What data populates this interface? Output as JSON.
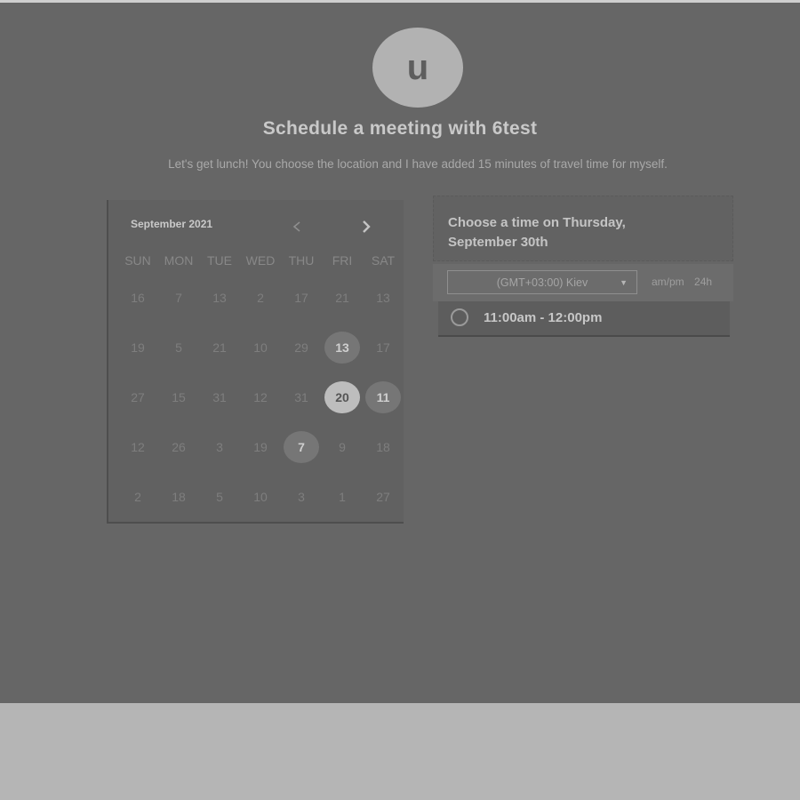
{
  "avatar": {
    "initial": "u"
  },
  "title": "Schedule a meeting with 6test",
  "subtitle": "Let's get lunch! You choose the location and I have added 15 minutes of travel time for myself.",
  "calendar": {
    "month_label": "September 2021",
    "prev_icon": "chevron-left-icon",
    "next_icon": "chevron-right-icon",
    "weekdays": [
      "SUN",
      "MON",
      "TUE",
      "WED",
      "THU",
      "FRI",
      "SAT"
    ],
    "days": [
      {
        "label": "16",
        "state": "dim"
      },
      {
        "label": "7",
        "state": "dim"
      },
      {
        "label": "13",
        "state": "dim"
      },
      {
        "label": "2",
        "state": "dim"
      },
      {
        "label": "17",
        "state": "dim"
      },
      {
        "label": "21",
        "state": "dim"
      },
      {
        "label": "13",
        "state": "dim"
      },
      {
        "label": "19",
        "state": "dim"
      },
      {
        "label": "5",
        "state": "dim"
      },
      {
        "label": "21",
        "state": "dim"
      },
      {
        "label": "10",
        "state": "dim"
      },
      {
        "label": "29",
        "state": "dim"
      },
      {
        "label": "13",
        "state": "avail"
      },
      {
        "label": "17",
        "state": "dim"
      },
      {
        "label": "27",
        "state": "dim"
      },
      {
        "label": "15",
        "state": "dim"
      },
      {
        "label": "31",
        "state": "dim"
      },
      {
        "label": "12",
        "state": "dim"
      },
      {
        "label": "31",
        "state": "dim"
      },
      {
        "label": "20",
        "state": "selected"
      },
      {
        "label": "11",
        "state": "avail"
      },
      {
        "label": "12",
        "state": "dim"
      },
      {
        "label": "26",
        "state": "dim"
      },
      {
        "label": "3",
        "state": "dim"
      },
      {
        "label": "19",
        "state": "dim"
      },
      {
        "label": "7",
        "state": "avail"
      },
      {
        "label": "9",
        "state": "dim"
      },
      {
        "label": "18",
        "state": "dim"
      },
      {
        "label": "2",
        "state": "dim"
      },
      {
        "label": "18",
        "state": "dim"
      },
      {
        "label": "5",
        "state": "dim"
      },
      {
        "label": "10",
        "state": "dim"
      },
      {
        "label": "3",
        "state": "dim"
      },
      {
        "label": "1",
        "state": "dim"
      },
      {
        "label": "27",
        "state": "dim"
      }
    ]
  },
  "time_panel": {
    "heading": "Choose a time on Thursday, September 30th",
    "timezone": "(GMT+03:00) Kiev",
    "format_ampm": "am/pm",
    "format_24h": "24h",
    "slots": [
      {
        "label": "11:00am - 12:00pm"
      }
    ]
  },
  "colors": {
    "background": "#666666",
    "footer": "#b5b5b5",
    "selected_day": "#bdbdbd",
    "available_day": "#767676"
  }
}
